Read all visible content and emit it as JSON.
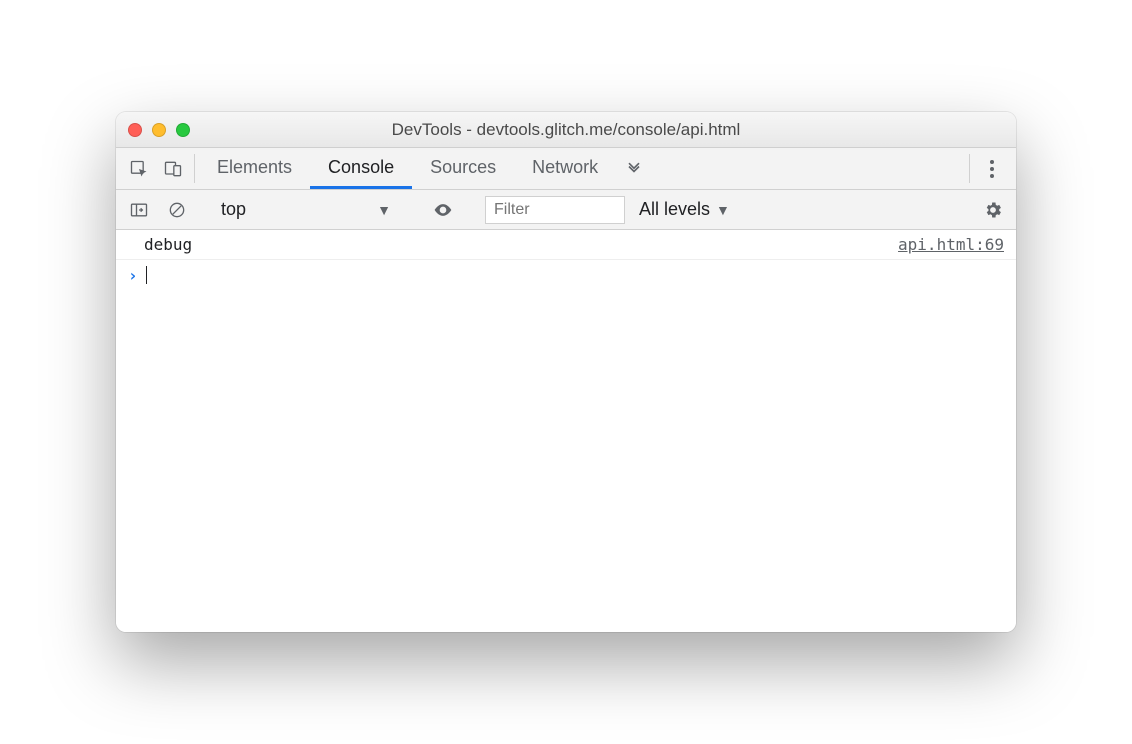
{
  "window": {
    "title": "DevTools - devtools.glitch.me/console/api.html"
  },
  "tabs": {
    "items": [
      "Elements",
      "Console",
      "Sources",
      "Network"
    ],
    "active_index": 1
  },
  "toolbar": {
    "context": "top",
    "filter_placeholder": "Filter",
    "levels_label": "All levels"
  },
  "console": {
    "entries": [
      {
        "message": "debug",
        "source": "api.html:69"
      }
    ]
  }
}
